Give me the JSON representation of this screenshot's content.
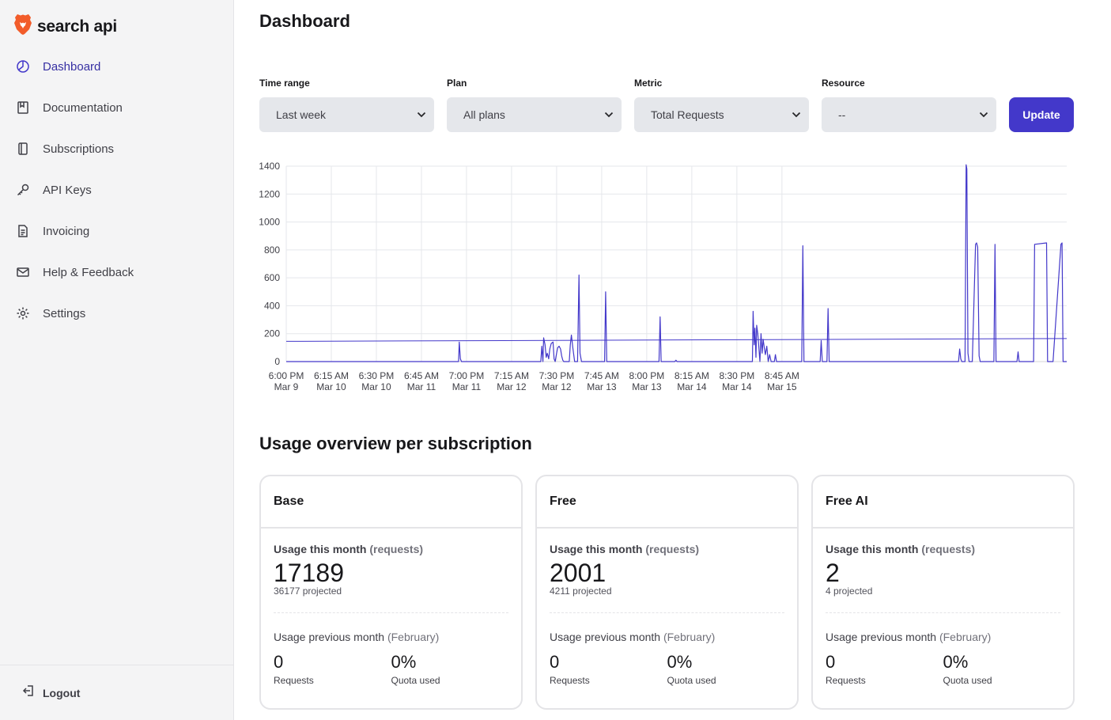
{
  "brand": {
    "name": "search api",
    "accent": "#4338ca",
    "logo_color": "#f25c2a"
  },
  "sidebar": {
    "items": [
      {
        "label": "Dashboard",
        "icon": "dashboard-icon",
        "active": true
      },
      {
        "label": "Documentation",
        "icon": "book-icon"
      },
      {
        "label": "Subscriptions",
        "icon": "subscription-icon"
      },
      {
        "label": "API Keys",
        "icon": "key-icon"
      },
      {
        "label": "Invoicing",
        "icon": "invoice-icon"
      },
      {
        "label": "Help & Feedback",
        "icon": "mail-icon"
      },
      {
        "label": "Settings",
        "icon": "gear-icon"
      }
    ],
    "logout_label": "Logout"
  },
  "header": {
    "title": "Dashboard"
  },
  "filters": {
    "time_range": {
      "label": "Time range",
      "value": "Last week"
    },
    "plan": {
      "label": "Plan",
      "value": "All plans"
    },
    "metric": {
      "label": "Metric",
      "value": "Total Requests"
    },
    "resource": {
      "label": "Resource",
      "value": "--"
    },
    "update_label": "Update"
  },
  "chart_data": {
    "type": "line",
    "title": "",
    "xlabel": "",
    "ylabel": "",
    "ylim": [
      0,
      1400
    ],
    "yticks": [
      0,
      200,
      400,
      600,
      800,
      1000,
      1200,
      1400
    ],
    "xtick_labels": [
      [
        "6:00 PM",
        "Mar 9"
      ],
      [
        "6:15 AM",
        "Mar 10"
      ],
      [
        "6:30 PM",
        "Mar 10"
      ],
      [
        "6:45 AM",
        "Mar 11"
      ],
      [
        "7:00 PM",
        "Mar 11"
      ],
      [
        "7:15 AM",
        "Mar 12"
      ],
      [
        "7:30 PM",
        "Mar 12"
      ],
      [
        "7:45 AM",
        "Mar 13"
      ],
      [
        "8:00 PM",
        "Mar 13"
      ],
      [
        "8:15 AM",
        "Mar 14"
      ],
      [
        "8:30 PM",
        "Mar 14"
      ],
      [
        "8:45 AM",
        "Mar 15"
      ]
    ],
    "grid": true,
    "series": [
      {
        "color": "#4338ca",
        "x_hours": [
          0,
          47.8,
          48,
          48.3,
          48.6,
          70.6,
          70.9,
          71.2,
          71.4,
          71.8,
          72.1,
          72.4,
          72.8,
          73.1,
          73.5,
          74.0,
          74.3,
          74.6,
          75.0,
          75.3,
          75.7,
          76.1,
          76.4,
          76.7,
          77.0,
          77.3,
          78.5,
          78.8,
          79.1,
          79.5,
          80.0,
          80.5,
          80.8,
          81.2,
          81.5,
          81.9,
          88.3,
          88.6,
          88.9,
          89.2,
          89.5,
          103.4,
          103.7,
          104.0,
          104.3,
          107.8,
          108.1,
          108.4,
          108.7,
          129.3,
          129.5,
          129.8,
          130.0,
          130.3,
          130.5,
          130.8,
          131.1,
          131.4,
          131.7,
          132.0,
          132.3,
          132.6,
          132.9,
          133.3,
          133.7,
          134.1,
          134.5,
          135.4,
          135.7,
          136.0,
          143.0,
          143.3,
          143.6,
          143.9,
          144.2,
          144.5,
          148.1,
          148.4,
          148.7,
          149.0,
          150.0,
          150.3,
          150.6,
          150.9,
          186.5,
          186.8,
          187.1,
          187.4,
          187.7,
          188.3,
          188.6,
          188.8,
          189.1,
          189.4,
          189.7,
          190.0,
          190.3,
          191.2,
          191.5,
          191.8,
          192.2,
          192.5,
          192.8,
          196.3,
          196.6,
          196.9,
          197.2,
          197.6,
          197.9,
          198.2,
          198.5,
          199.0,
          199.3,
          199.6,
          199.9,
          202.7,
          203.0,
          203.3,
          203.6,
          207.0,
          207.3,
          207.6,
          210.9,
          211.2,
          211.5,
          211.8,
          212.1,
          212.4,
          212.7,
          214.9,
          215.2,
          215.5,
          215.8,
          216.1,
          216.4
        ],
        "y": [
          0,
          0,
          140,
          20,
          0,
          0,
          110,
          0,
          170,
          120,
          30,
          60,
          20,
          90,
          130,
          140,
          20,
          0,
          60,
          100,
          110,
          90,
          40,
          10,
          0,
          0,
          0,
          120,
          190,
          100,
          0,
          0,
          0,
          620,
          60,
          0,
          0,
          500,
          0,
          0,
          0,
          0,
          320,
          0,
          0,
          0,
          10,
          0,
          0,
          0,
          360,
          120,
          240,
          30,
          260,
          200,
          100,
          0,
          200,
          60,
          160,
          100,
          50,
          110,
          0,
          50,
          0,
          0,
          50,
          0,
          0,
          830,
          0,
          0,
          0,
          0,
          0,
          150,
          0,
          0,
          0,
          380,
          0,
          0,
          0,
          90,
          20,
          0,
          0,
          0,
          1410,
          1380,
          60,
          0,
          0,
          0,
          0,
          840,
          850,
          820,
          40,
          0,
          0,
          0,
          840,
          0,
          0,
          0,
          0,
          0,
          0,
          0,
          0,
          0,
          0,
          0,
          70,
          0,
          0,
          0,
          0,
          840,
          850,
          0,
          0,
          0,
          0,
          0,
          0,
          840,
          850,
          0,
          0,
          0,
          0
        ]
      }
    ],
    "average_line": {
      "color": "#4338ca",
      "y_start": 145,
      "y_end": 165
    },
    "x_total_hours": 216.5
  },
  "usage": {
    "section_title": "Usage overview per subscription",
    "cards": [
      {
        "name": "Base",
        "usage_label": "Usage this month",
        "usage_unit": "(requests)",
        "usage_value": "17189",
        "projected": "36177 projected",
        "prev_label": "Usage previous month",
        "prev_month": "(February)",
        "prev_requests": "0",
        "prev_requests_label": "Requests",
        "prev_quota": "0%",
        "prev_quota_label": "Quota used"
      },
      {
        "name": "Free",
        "usage_label": "Usage this month",
        "usage_unit": "(requests)",
        "usage_value": "2001",
        "projected": "4211 projected",
        "prev_label": "Usage previous month",
        "prev_month": "(February)",
        "prev_requests": "0",
        "prev_requests_label": "Requests",
        "prev_quota": "0%",
        "prev_quota_label": "Quota used"
      },
      {
        "name": "Free AI",
        "usage_label": "Usage this month",
        "usage_unit": "(requests)",
        "usage_value": "2",
        "projected": "4 projected",
        "prev_label": "Usage previous month",
        "prev_month": "(February)",
        "prev_requests": "0",
        "prev_requests_label": "Requests",
        "prev_quota": "0%",
        "prev_quota_label": "Quota used"
      }
    ]
  }
}
